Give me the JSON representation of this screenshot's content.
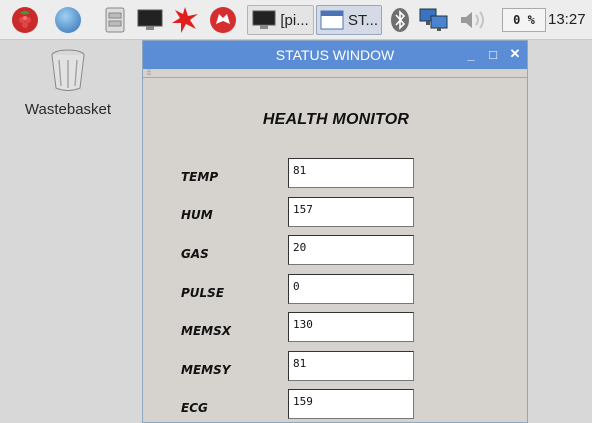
{
  "taskbar": {
    "apps": [
      {
        "icon": "raspberry-menu-icon"
      },
      {
        "icon": "web-browser-icon"
      },
      {
        "icon": "file-manager-icon"
      },
      {
        "icon": "terminal-icon"
      },
      {
        "icon": "math-kernel-icon"
      },
      {
        "icon": "wolfram-icon"
      }
    ],
    "windows": [
      {
        "icon": "terminal-icon",
        "label": "[pi..."
      },
      {
        "icon": "window-icon",
        "label": "ST..."
      }
    ],
    "tray": {
      "bluetooth_icon": "bluetooth-icon",
      "network_icon": "network-icon",
      "volume_icon": "volume-icon",
      "cpu_usage": "0 %",
      "clock": "13:27"
    }
  },
  "desktop": {
    "icons": [
      {
        "icon": "trash-icon",
        "label": "Wastebasket"
      }
    ]
  },
  "window": {
    "title": "STATUS WINDOW",
    "controls": {
      "minimize": "_",
      "maximize": "□",
      "close": "✕"
    },
    "heading": "HEALTH MONITOR",
    "fields": [
      {
        "label": "TEMP",
        "value": "81"
      },
      {
        "label": "HUM",
        "value": "157"
      },
      {
        "label": "GAS",
        "value": "20"
      },
      {
        "label": "PULSE",
        "value": "0"
      },
      {
        "label": "MEMSX",
        "value": "130"
      },
      {
        "label": "MEMSY",
        "value": "81"
      },
      {
        "label": "ECG",
        "value": "159"
      }
    ]
  }
}
